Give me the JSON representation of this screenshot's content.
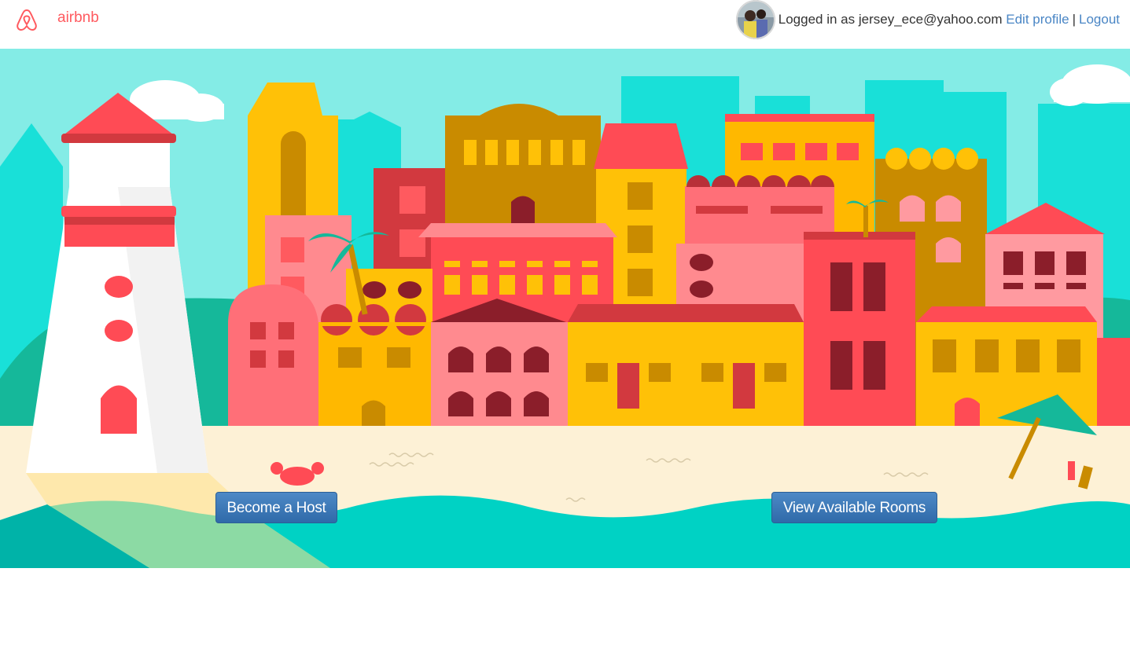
{
  "header": {
    "brand": "airbnb",
    "logo_icon": "airbnb-logo-icon",
    "logged_in_prefix": "Logged in as",
    "user_email": "jersey_ece@yahoo.com",
    "edit_profile": "Edit profile",
    "separator": "|",
    "logout": "Logout"
  },
  "hero": {
    "illustration": "coastal-town-illustration",
    "become_host": "Become a Host",
    "view_rooms": "View Available Rooms"
  },
  "colors": {
    "brand": "#ff5a5f",
    "link": "#4a86c5",
    "button": "#3a77b8",
    "sky": "#84ece6",
    "sea": "#00d2c4",
    "sand": "#fdf1d6"
  }
}
